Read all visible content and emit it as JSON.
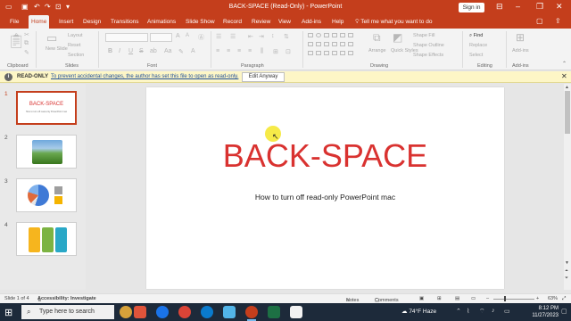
{
  "window": {
    "title": "BACK-SPACE (Read-Only)  -  PowerPoint",
    "sign_in": "Sign in"
  },
  "tabs": [
    "File",
    "Home",
    "Insert",
    "Design",
    "Transitions",
    "Animations",
    "Slide Show",
    "Record",
    "Review",
    "View",
    "Add-ins",
    "Help"
  ],
  "active_tab": "Home",
  "tell_me": "Tell me what you want to do",
  "ribbon": {
    "groups": {
      "clipboard": "Clipboard",
      "slides": "Slides",
      "font": "Font",
      "paragraph": "Paragraph",
      "drawing": "Drawing",
      "editing": "Editing",
      "addins": "Add-ins"
    },
    "slides_group": {
      "new_slide": "New Slide",
      "layout": "Layout",
      "reset": "Reset",
      "section": "Section"
    },
    "drawing_group": {
      "arrange": "Arrange",
      "quick_styles": "Quick Styles",
      "shape_fill": "Shape Fill",
      "shape_outline": "Shape Outline",
      "shape_effects": "Shape Effects"
    },
    "editing_group": {
      "find": "Find",
      "replace": "Replace",
      "select": "Select"
    },
    "addins_btn": "Add-ins",
    "font_bold": "B",
    "font_italic": "I",
    "font_underline": "U",
    "font_strike": "S"
  },
  "readonly_bar": {
    "label": "READ-ONLY",
    "message": "To prevent accidental changes, the author has set this file to open as read-only.",
    "button": "Edit Anyway"
  },
  "thumbnails": [
    {
      "num": "1",
      "title": "BACK-SPACE",
      "subtitle": "How to turn off read-only PowerPoint mac"
    },
    {
      "num": "2"
    },
    {
      "num": "3"
    },
    {
      "num": "4"
    }
  ],
  "slide": {
    "title": "BACK-SPACE",
    "subtitle": "How to turn off read-only PowerPoint mac"
  },
  "status": {
    "slide_count": "Slide 1 of 4",
    "accessibility": "Accessibility: Investigate",
    "notes": "Notes",
    "comments": "Comments",
    "zoom": "63%"
  },
  "taskbar": {
    "search": "Type here to search",
    "weather": "74°F  Haze",
    "time": "8:12 PM",
    "date": "11/27/2023"
  },
  "colors": {
    "accent": "#c43e1c",
    "title_red": "#d93230",
    "readonly_bg": "#fdf6c6"
  }
}
